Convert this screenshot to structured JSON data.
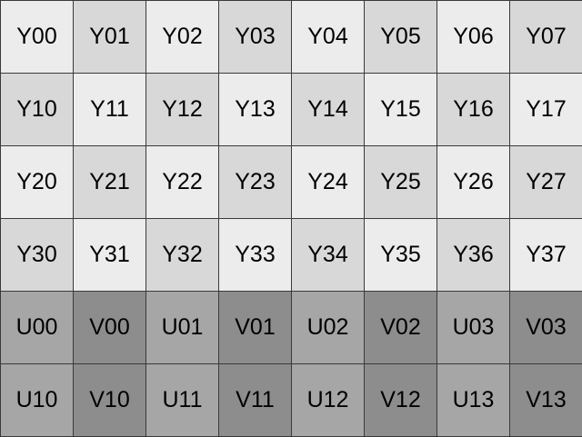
{
  "rows": [
    {
      "cells": [
        {
          "label": "Y00",
          "color": "#ececec"
        },
        {
          "label": "Y01",
          "color": "#d8d8d8"
        },
        {
          "label": "Y02",
          "color": "#ececec"
        },
        {
          "label": "Y03",
          "color": "#d8d8d8"
        },
        {
          "label": "Y04",
          "color": "#ececec"
        },
        {
          "label": "Y05",
          "color": "#d8d8d8"
        },
        {
          "label": "Y06",
          "color": "#ececec"
        },
        {
          "label": "Y07",
          "color": "#d8d8d8"
        }
      ]
    },
    {
      "cells": [
        {
          "label": "Y10",
          "color": "#d8d8d8"
        },
        {
          "label": "Y11",
          "color": "#ececec"
        },
        {
          "label": "Y12",
          "color": "#d8d8d8"
        },
        {
          "label": "Y13",
          "color": "#ececec"
        },
        {
          "label": "Y14",
          "color": "#d8d8d8"
        },
        {
          "label": "Y15",
          "color": "#ececec"
        },
        {
          "label": "Y16",
          "color": "#d8d8d8"
        },
        {
          "label": "Y17",
          "color": "#ececec"
        }
      ]
    },
    {
      "cells": [
        {
          "label": "Y20",
          "color": "#ececec"
        },
        {
          "label": "Y21",
          "color": "#d8d8d8"
        },
        {
          "label": "Y22",
          "color": "#ececec"
        },
        {
          "label": "Y23",
          "color": "#d8d8d8"
        },
        {
          "label": "Y24",
          "color": "#ececec"
        },
        {
          "label": "Y25",
          "color": "#d8d8d8"
        },
        {
          "label": "Y26",
          "color": "#ececec"
        },
        {
          "label": "Y27",
          "color": "#d8d8d8"
        }
      ]
    },
    {
      "cells": [
        {
          "label": "Y30",
          "color": "#d8d8d8"
        },
        {
          "label": "Y31",
          "color": "#ececec"
        },
        {
          "label": "Y32",
          "color": "#d8d8d8"
        },
        {
          "label": "Y33",
          "color": "#ececec"
        },
        {
          "label": "Y34",
          "color": "#d8d8d8"
        },
        {
          "label": "Y35",
          "color": "#ececec"
        },
        {
          "label": "Y36",
          "color": "#d8d8d8"
        },
        {
          "label": "Y37",
          "color": "#ececec"
        }
      ]
    },
    {
      "cells": [
        {
          "label": "U00",
          "color": "#a6a6a6"
        },
        {
          "label": "V00",
          "color": "#8d8d8d"
        },
        {
          "label": "U01",
          "color": "#a6a6a6"
        },
        {
          "label": "V01",
          "color": "#8d8d8d"
        },
        {
          "label": "U02",
          "color": "#a6a6a6"
        },
        {
          "label": "V02",
          "color": "#8d8d8d"
        },
        {
          "label": "U03",
          "color": "#a6a6a6"
        },
        {
          "label": "V03",
          "color": "#8d8d8d"
        }
      ]
    },
    {
      "cells": [
        {
          "label": "U10",
          "color": "#a6a6a6"
        },
        {
          "label": "V10",
          "color": "#8d8d8d"
        },
        {
          "label": "U11",
          "color": "#a6a6a6"
        },
        {
          "label": "V11",
          "color": "#8d8d8d"
        },
        {
          "label": "U12",
          "color": "#a6a6a6"
        },
        {
          "label": "V12",
          "color": "#8d8d8d"
        },
        {
          "label": "U13",
          "color": "#a6a6a6"
        },
        {
          "label": "V13",
          "color": "#8d8d8d"
        }
      ]
    }
  ]
}
